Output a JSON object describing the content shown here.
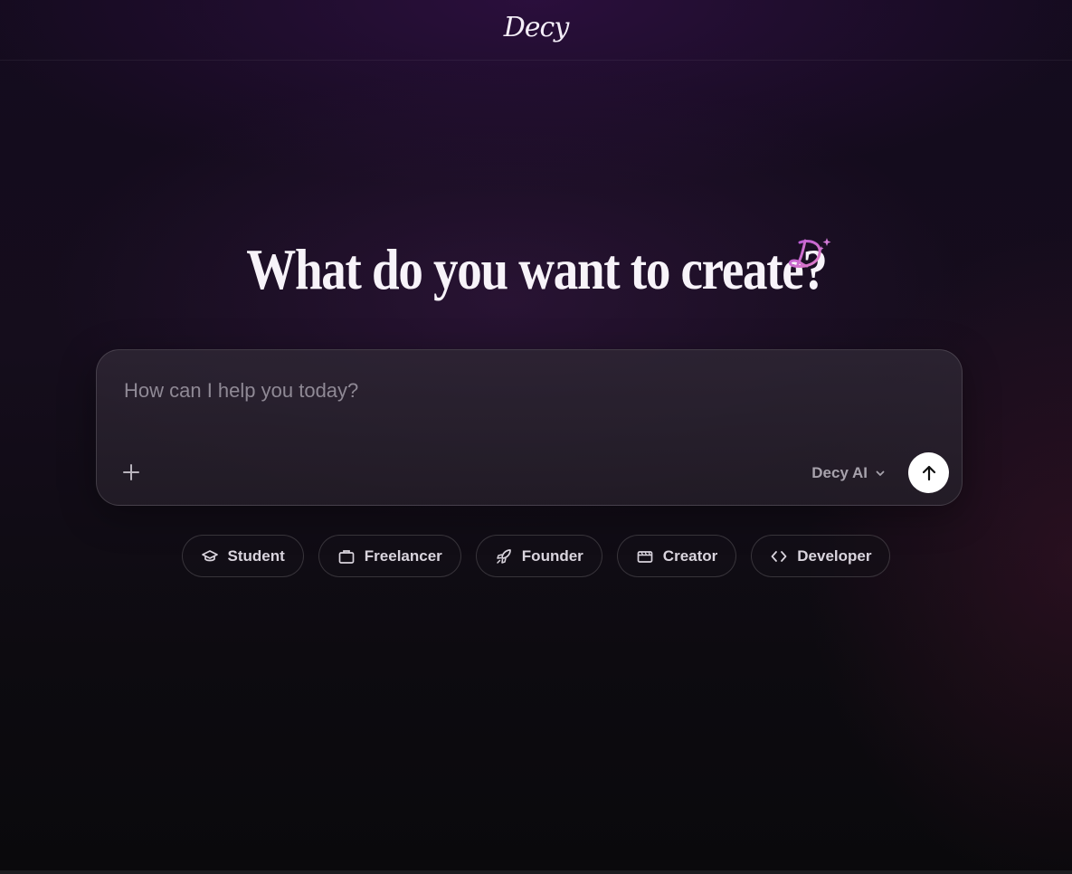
{
  "header": {
    "brand": "Decy"
  },
  "hero": {
    "title": "What do you want to create?",
    "mark_icon": "decy-sparkle-logo-icon"
  },
  "prompt": {
    "placeholder": "How can I help you today?",
    "value": "",
    "add_icon": "plus-icon",
    "model_label": "Decy AI",
    "model_icon": "chevron-down-icon",
    "send_icon": "arrow-up-icon"
  },
  "personas": [
    {
      "label": "Student",
      "icon": "graduation-cap-icon"
    },
    {
      "label": "Freelancer",
      "icon": "briefcase-icon"
    },
    {
      "label": "Founder",
      "icon": "rocket-icon"
    },
    {
      "label": "Creator",
      "icon": "clapperboard-icon"
    },
    {
      "label": "Developer",
      "icon": "code-icon"
    }
  ],
  "colors": {
    "accent": "#c95fd6",
    "send_button": "#ffffff"
  }
}
